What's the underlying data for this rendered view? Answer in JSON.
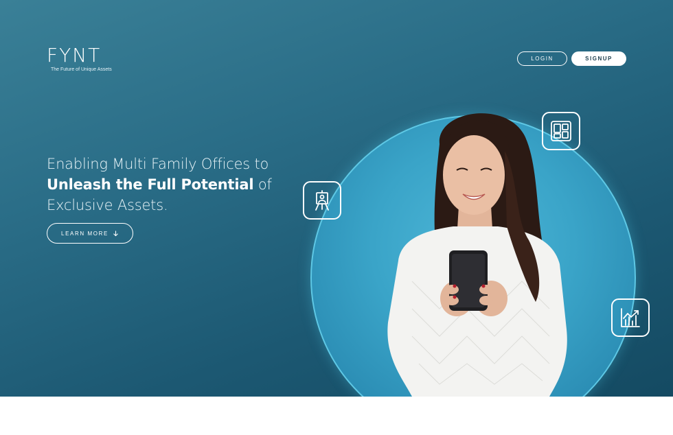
{
  "brand": {
    "name": "FYNT",
    "tagline": "The Future of Unique Assets"
  },
  "nav": {
    "login_label": "LOGIN",
    "signup_label": "SIGNUP"
  },
  "hero": {
    "line1": "Enabling Multi Family Offices to",
    "line2_strong": "Unleash the Full Potential",
    "line2_rest": " of",
    "line3": "Exclusive Assets.",
    "cta_label": "LEARN MORE"
  },
  "icons": {
    "art": "easel-icon",
    "dashboard": "dashboard-grid-icon",
    "growth": "growth-chart-icon",
    "cta": "arrow-down-icon"
  },
  "colors": {
    "hero_top": "#3a8097",
    "hero_bottom": "#144a62",
    "circle": "#3aa4c8",
    "circle_ring": "#5ec8e5",
    "signup_text": "#1d3e4e"
  }
}
